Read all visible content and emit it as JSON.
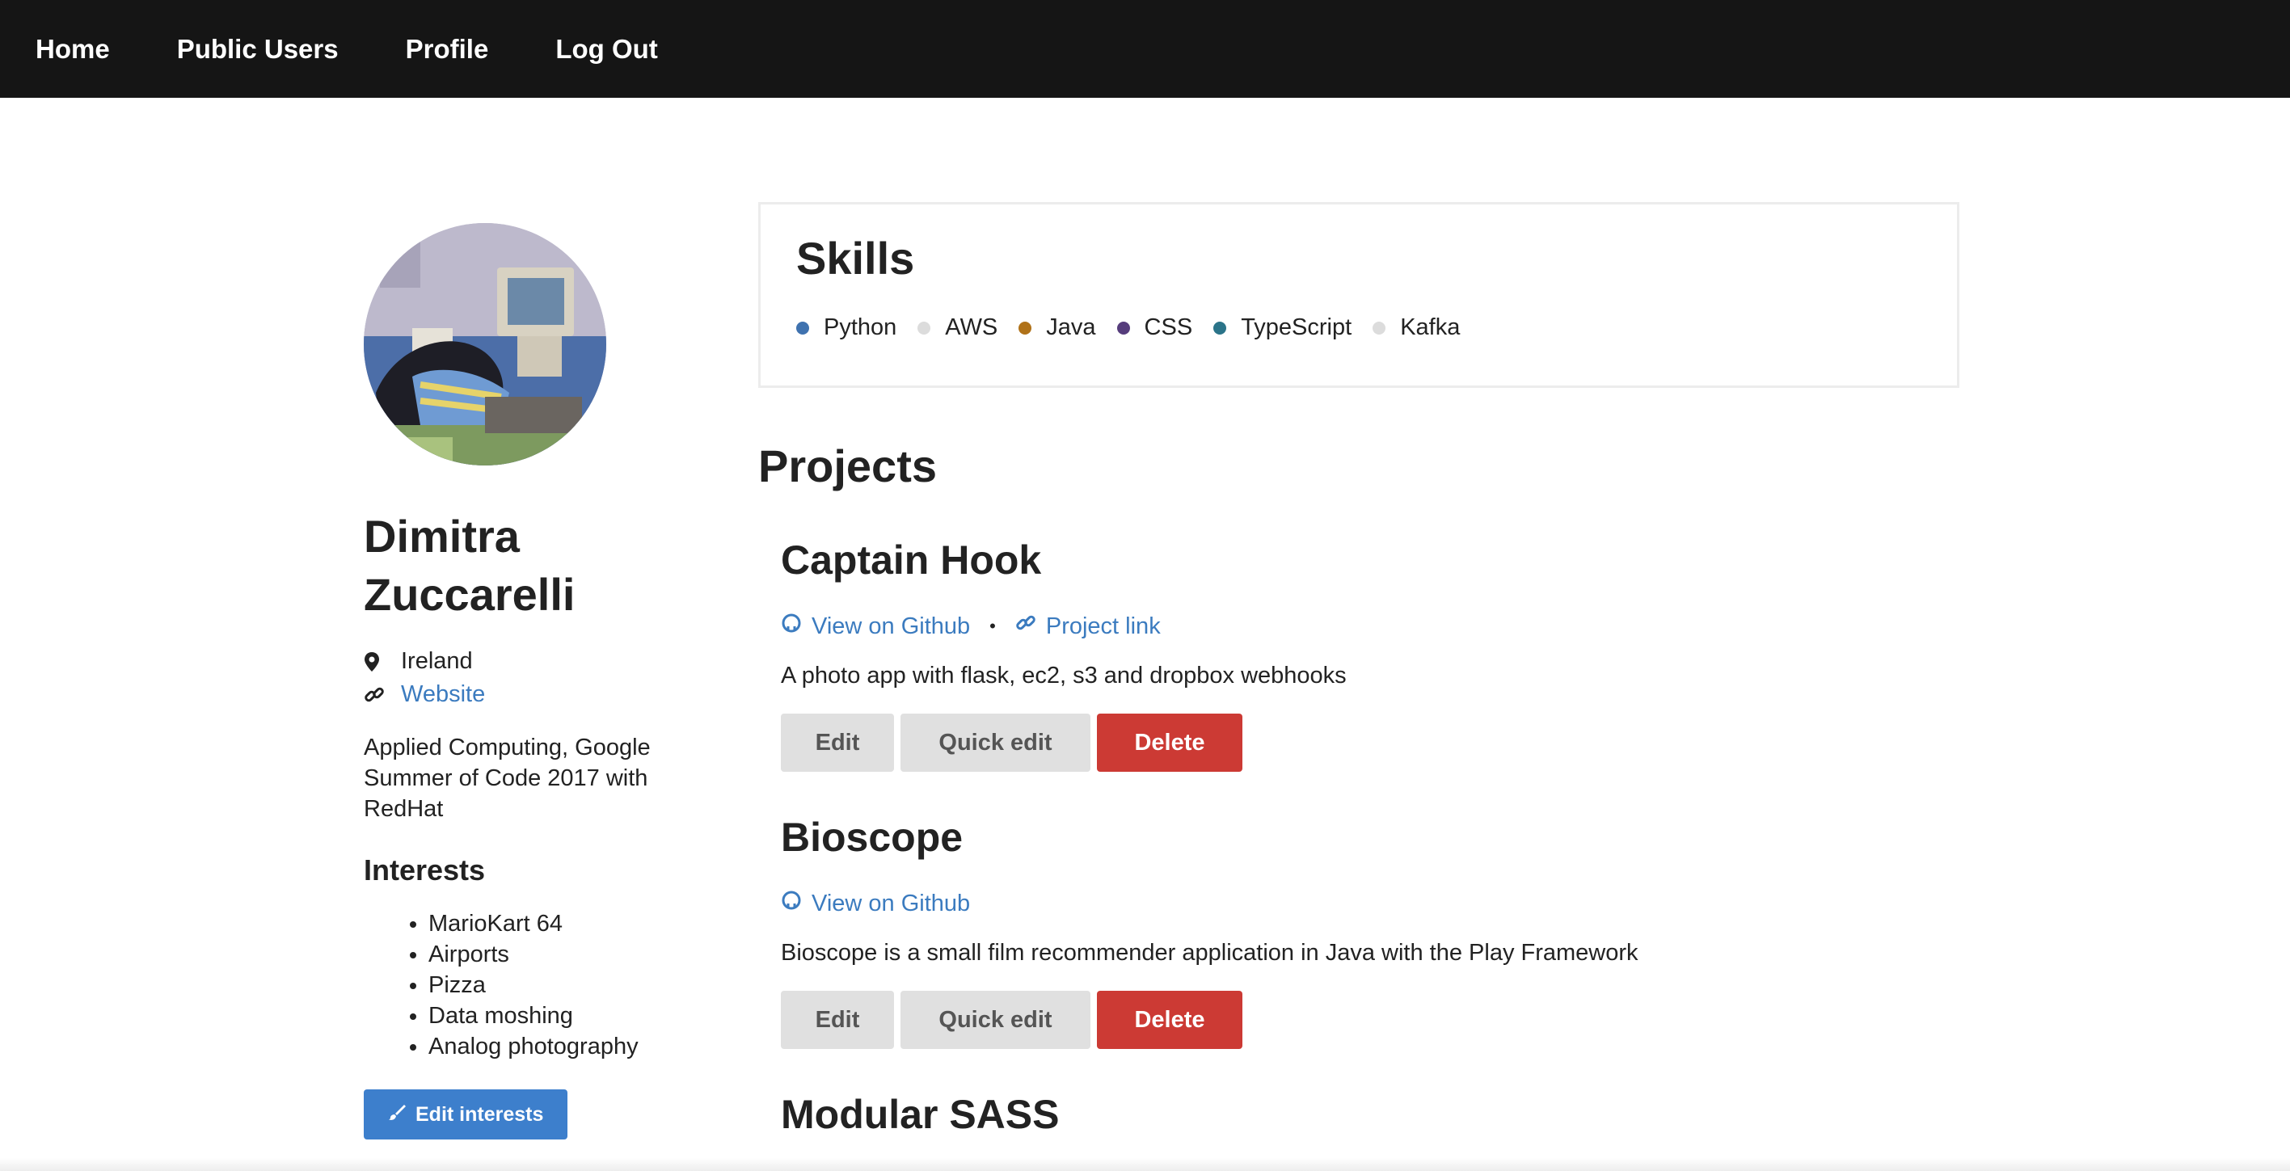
{
  "nav": {
    "items": [
      "Home",
      "Public Users",
      "Profile",
      "Log Out"
    ]
  },
  "profile": {
    "name_line1": "Dimitra",
    "name_line2": "Zuccarelli",
    "location": "Ireland",
    "website_label": "Website",
    "bio": "Applied Computing,  Google Summer of Code 2017 with RedHat",
    "interests_title": "Interests",
    "interests": [
      "MarioKart 64",
      "Airports",
      "Pizza",
      "Data moshing",
      "Analog photography"
    ],
    "edit_interests_label": "Edit interests"
  },
  "skills": {
    "title": "Skills",
    "items": [
      {
        "label": "Python",
        "color": "#3f72af"
      },
      {
        "label": "AWS",
        "color": "#dcdcdc"
      },
      {
        "label": "Java",
        "color": "#b07219"
      },
      {
        "label": "CSS",
        "color": "#563d7c"
      },
      {
        "label": "TypeScript",
        "color": "#2b7489"
      },
      {
        "label": "Kafka",
        "color": "#dcdcdc"
      }
    ]
  },
  "projects": {
    "title": "Projects",
    "items": [
      {
        "name": "Captain Hook",
        "github_label": "View on Github",
        "project_link_label": "Project link",
        "description": "A photo app with flask, ec2, s3 and dropbox webhooks",
        "edit_label": "Edit",
        "quick_edit_label": "Quick edit",
        "delete_label": "Delete"
      },
      {
        "name": "Bioscope",
        "github_label": "View on Github",
        "description": "Bioscope is a small film recommender application in Java with the Play Framework",
        "edit_label": "Edit",
        "quick_edit_label": "Quick edit",
        "delete_label": "Delete"
      },
      {
        "name": "Modular SASS"
      }
    ]
  },
  "colors": {
    "nav_bg": "#151515",
    "link": "#3b7bbf",
    "primary_button": "#3d7fcc",
    "delete_button": "#cc3a34",
    "secondary_button": "#e0e0e0"
  }
}
